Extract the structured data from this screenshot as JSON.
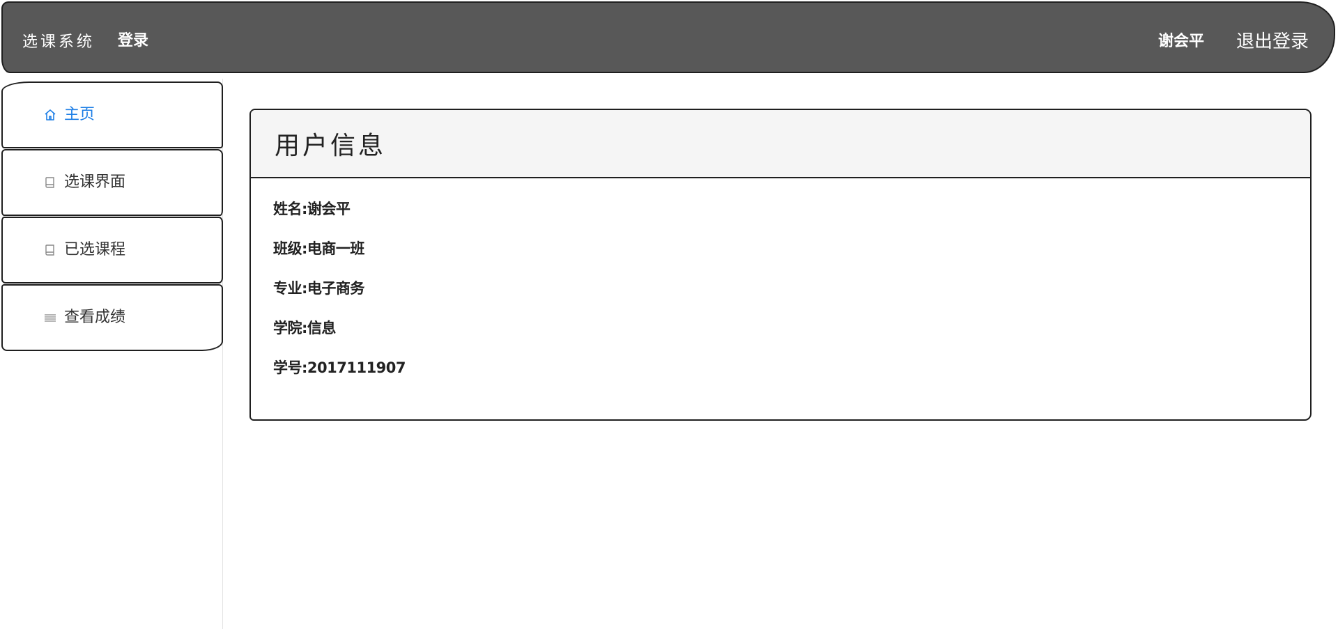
{
  "header": {
    "brand": "选课系统",
    "login_label": "登录",
    "username": "谢会平",
    "logout_label": "退出登录"
  },
  "sidebar": {
    "items": [
      {
        "label": "主页",
        "icon": "home-icon",
        "active": true
      },
      {
        "label": "选课界面",
        "icon": "book-icon",
        "active": false
      },
      {
        "label": "已选课程",
        "icon": "book-icon",
        "active": false
      },
      {
        "label": "查看成绩",
        "icon": "list-icon",
        "active": false
      }
    ]
  },
  "panel": {
    "title": "用户信息",
    "fields": [
      {
        "text": "姓名:谢会平"
      },
      {
        "text": "班级:电商一班"
      },
      {
        "text": "专业:电子商务"
      },
      {
        "text": "学院:信息"
      },
      {
        "text": "学号:2017111907"
      }
    ]
  },
  "colors": {
    "topbar_bg": "#585858",
    "active_accent": "#1e7fe6",
    "border": "#1f1f1f",
    "panel_header_bg": "#f5f5f5"
  }
}
